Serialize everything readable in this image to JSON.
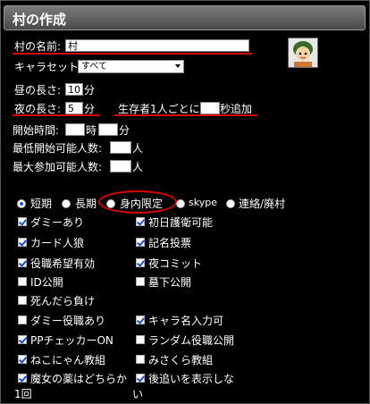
{
  "title": "村の作成",
  "form": {
    "village_name_label": "村の名前:",
    "village_name_value": "村",
    "charset_label": "キャラセット:",
    "charset_value": "すべて",
    "day_length_label": "昼の長さ:",
    "day_length_value": "10",
    "day_length_unit": "分",
    "night_length_label": "夜の長さ:",
    "night_length_value": "5",
    "night_length_unit": "分",
    "survivor_prefix": "生存者1人ごとに",
    "survivor_value": "",
    "survivor_suffix": "秒追加",
    "start_time_label": "開始時間:",
    "start_hour_value": "",
    "hour_unit": "時",
    "start_min_value": "",
    "min_unit": "分",
    "min_players_label": "最低開始可能人数:",
    "min_players_value": "",
    "max_players_label": "最大参加可能人数:",
    "max_players_value": "",
    "people_unit": "人"
  },
  "modes": [
    {
      "label": "短期",
      "selected": true
    },
    {
      "label": "長期",
      "selected": false
    },
    {
      "label": "身内限定",
      "selected": false
    },
    {
      "label": "skype",
      "selected": false
    },
    {
      "label": "連絡/廃村",
      "selected": false
    }
  ],
  "options_left": [
    {
      "label": "ダミーあり",
      "checked": true
    },
    {
      "label": "カード人狼",
      "checked": true
    },
    {
      "label": "役職希望有効",
      "checked": true
    },
    {
      "label": "ID公開",
      "checked": false
    },
    {
      "label": "死んだら負け",
      "checked": false
    },
    {
      "label": "ダミー役職あり",
      "checked": false
    },
    {
      "label": "PPチェッカーON",
      "checked": true
    },
    {
      "label": "ねこにゃん教組",
      "checked": true
    },
    {
      "label": "魔女の薬はどちらか",
      "checked": true
    }
  ],
  "options_left_wrap": "1回",
  "options_right": [
    {
      "label": "初日護衛可能",
      "checked": true
    },
    {
      "label": "記名投票",
      "checked": true
    },
    {
      "label": "夜コミット",
      "checked": true
    },
    {
      "label": "墓下公開",
      "checked": false
    },
    {
      "label": "",
      "checked": null
    },
    {
      "label": "キャラ名入力可",
      "checked": true
    },
    {
      "label": "ランダム役職公開",
      "checked": false
    },
    {
      "label": "みさくら教組",
      "checked": false
    },
    {
      "label": "後追いを表示しな",
      "checked": true
    }
  ],
  "options_right_wrap": "い"
}
